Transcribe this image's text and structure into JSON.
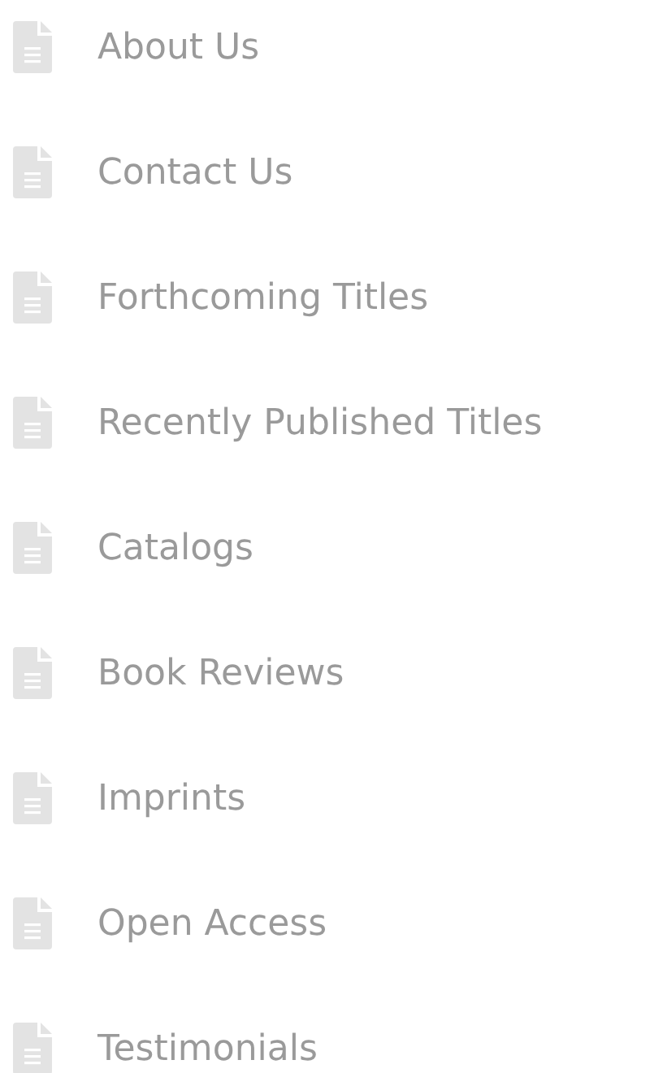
{
  "links": [
    {
      "label": "About Us"
    },
    {
      "label": "Contact Us"
    },
    {
      "label": "Forthcoming Titles"
    },
    {
      "label": "Recently Published Titles"
    },
    {
      "label": "Catalogs"
    },
    {
      "label": "Book Reviews"
    },
    {
      "label": "Imprints"
    },
    {
      "label": "Open Access"
    },
    {
      "label": "Testimonials"
    }
  ]
}
